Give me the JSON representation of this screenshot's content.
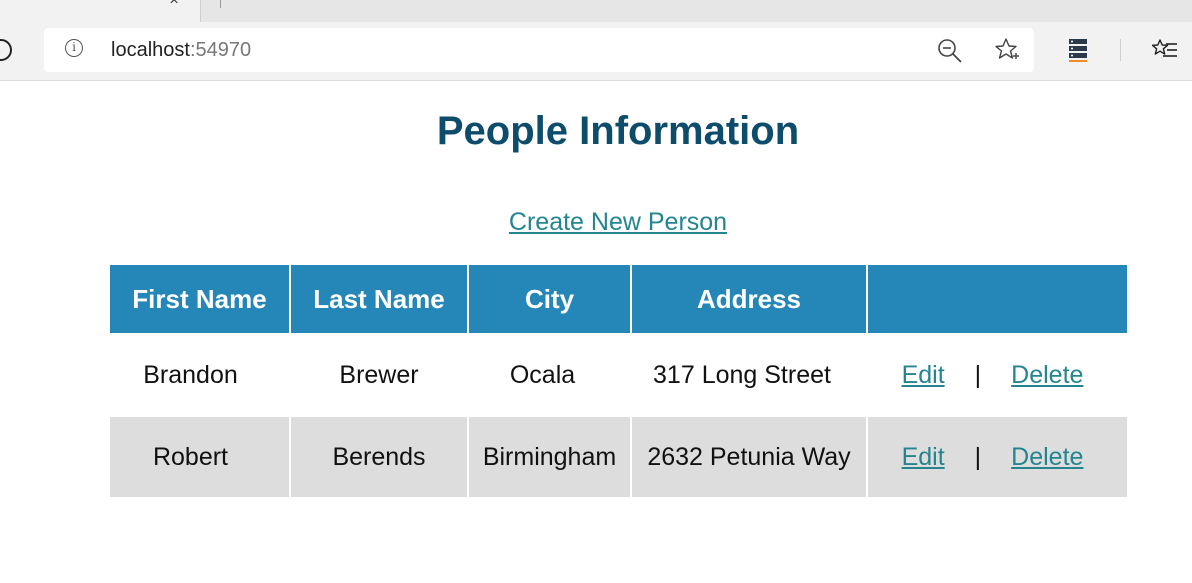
{
  "browser": {
    "tab_close_glyph": "×",
    "url_host": "localhost",
    "url_port": ":54970"
  },
  "page": {
    "title": "People Information",
    "create_link": "Create New Person"
  },
  "table": {
    "headers": [
      "First Name",
      "Last Name",
      "City",
      "Address",
      ""
    ],
    "rows": [
      {
        "first": "Brandon",
        "last": "Brewer",
        "city": "Ocala",
        "address": "317 Long Street",
        "edit": "Edit",
        "sep": "|",
        "delete": "Delete"
      },
      {
        "first": "Robert",
        "last": "Berends",
        "city": "Birmingham",
        "address": "2632 Petunia Way",
        "edit": "Edit",
        "sep": "|",
        "delete": "Delete"
      }
    ]
  },
  "colors": {
    "title": "#0e4c6c",
    "header_bg": "#2587b8",
    "link": "#23858f",
    "alt_row_bg": "#dddddd"
  },
  "icons": [
    "refresh-icon",
    "info-icon",
    "zoom-out-icon",
    "favorite-star-icon",
    "collections-icon",
    "favorites-list-icon",
    "close-icon"
  ]
}
